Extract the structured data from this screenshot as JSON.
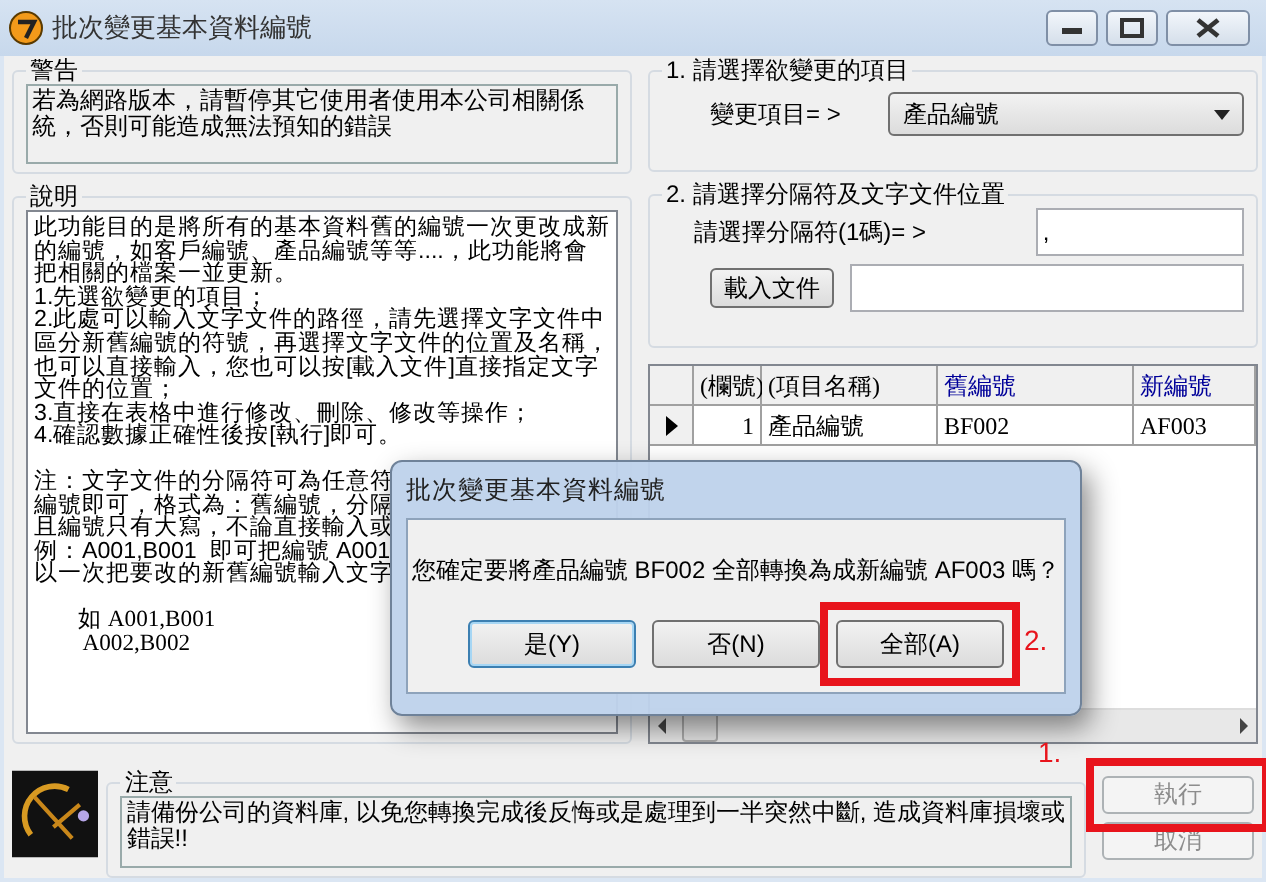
{
  "window": {
    "title": "批次變更基本資料編號"
  },
  "warning": {
    "title": "警告",
    "text": "若為網路版本，請暫停其它使用者使用本公司相關係統，否則可能造成無法預知的錯誤"
  },
  "description": {
    "title": "說明",
    "paragraphs": [
      {
        "kind": "plain",
        "lines": [
          "此功能目的是將所有的基本資料舊的編號一次更改成新",
          "的編號，如客戶編號、產品編號等等....，此功能將會",
          "把相關的檔案一並更新。",
          "1.先選欲變更的項目；",
          "2.此處可以輸入文字文件的路徑，請先選擇文字文件中",
          "區分新舊編號的符號，再選擇文字文件的位置及名稱，",
          "也可以直接輸入，您也可以按[載入文件]直接指定文字",
          "文件的位置；",
          "3.直接在表格中進行修改、刪除、修改等操作；",
          "4.確認數據正確性後按[執行]即可。"
        ]
      },
      {
        "kind": "plain",
        "lines": [
          "注：文字文件的分隔符可為任意符",
          "編號即可，格式為：舊編號，分隔",
          "且編號只有大寫，不論直接輸入或",
          "例：A001,B001  即可把編號 A001",
          "以一次把要改的新舊編號輸入文字"
        ]
      },
      {
        "kind": "example",
        "lines": [
          "如 A001,B001",
          " A002,B002"
        ]
      }
    ]
  },
  "step1": {
    "title": "1. 請選擇欲變更的項目",
    "label": "變更項目= >",
    "value": "產品編號"
  },
  "step2": {
    "title": "2. 請選擇分隔符及文字文件位置",
    "separator_label": "請選擇分隔符(1碼)= >",
    "separator": ",",
    "load_button": "載入文件"
  },
  "table": {
    "columns": [
      {
        "label": "(欄號)",
        "kind": "fixed"
      },
      {
        "label": "(項目名稱)",
        "kind": "fixed"
      },
      {
        "label": "舊編號",
        "kind": "editable"
      },
      {
        "label": "新編號",
        "kind": "editable"
      }
    ],
    "rows": [
      {
        "selected": true,
        "cells": [
          "1",
          "產品編號",
          "BF002",
          "AF003"
        ]
      }
    ]
  },
  "notice": {
    "title": "注意",
    "text": "請備份公司的資料庫, 以免您轉換完成後反悔或是處理到一半突然中斷, 造成資料庫損壞或錯誤!!"
  },
  "buttons": [
    {
      "label": "執行",
      "disabled": true,
      "annotation": "1."
    },
    {
      "label": "取消",
      "disabled": true
    }
  ],
  "dialog": {
    "title": "批次變更基本資料編號",
    "message": "您確定要將產品編號 BF002 全部轉換為成新編號 AF003 嗎？",
    "buttons": [
      {
        "label": "是(Y)",
        "focused": true
      },
      {
        "label": "否(N)",
        "focused": false
      },
      {
        "label": "全部(A)",
        "focused": false,
        "annotation": "2."
      }
    ]
  }
}
